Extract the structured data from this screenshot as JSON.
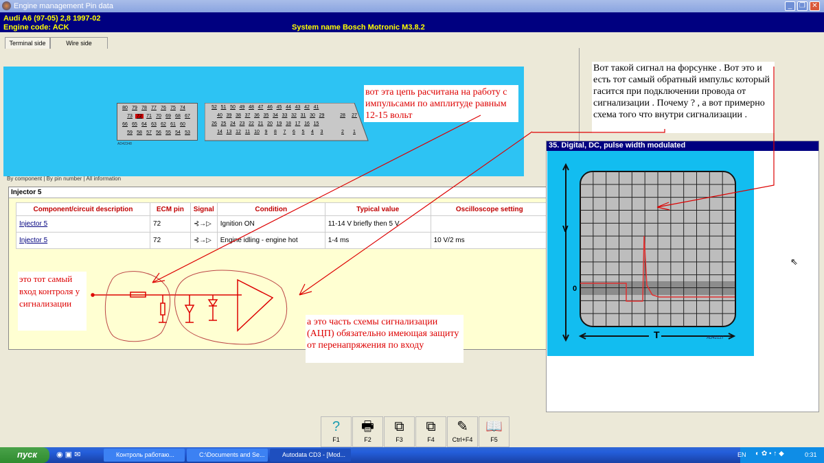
{
  "window": {
    "title": "Engine management Pin data",
    "minimize": "_",
    "maximize": "❐",
    "close": "✕"
  },
  "header": {
    "vehicle": "Audi   A6 (97-05) 2,8  1997-02",
    "engine_code": "Engine code: ACK",
    "system_name": "System name Bosch Motronic M3.8.2"
  },
  "tabs": [
    "Terminal side",
    "Wire side"
  ],
  "connector": {
    "left_rows": [
      [
        "80",
        "79",
        "78",
        "77",
        "76",
        "75",
        "74"
      ],
      [
        "73",
        "72",
        "71",
        "70",
        "69",
        "68",
        "67"
      ],
      [
        "66",
        "65",
        "64",
        "63",
        "62",
        "61",
        "60"
      ],
      [
        "59",
        "58",
        "57",
        "56",
        "55",
        "54",
        "53"
      ]
    ],
    "right_rows": [
      [
        "52",
        "51",
        "50",
        "49",
        "48",
        "47",
        "46",
        "45",
        "44",
        "43",
        "42",
        "41"
      ],
      [
        "40",
        "39",
        "38",
        "37",
        "36",
        "35",
        "34",
        "33",
        "32",
        "31",
        "30",
        "29",
        "28",
        "27"
      ],
      [
        "26",
        "25",
        "24",
        "23",
        "22",
        "21",
        "20",
        "19",
        "18",
        "17",
        "16",
        "15"
      ],
      [
        "14",
        "13",
        "12",
        "11",
        "10",
        "9",
        "8",
        "7",
        "6",
        "5",
        "4",
        "3",
        "2",
        "1"
      ]
    ],
    "highlighted_pin": "72",
    "highlight_color": "#cc0000",
    "ref": "AD42348"
  },
  "subtabs": "By component | By pin number | All information",
  "component": {
    "title": "Injector 5",
    "columns": [
      "Component/circuit description",
      "ECM pin",
      "Signal",
      "Condition",
      "Typical value",
      "Oscilloscope setting"
    ],
    "rows": [
      {
        "desc": "Injector 5",
        "pin": "72",
        "signal": "⊰→▷",
        "condition": "Ignition ON",
        "typical": "11-14 V briefly then 5 V",
        "scope": ""
      },
      {
        "desc": "Injector 5",
        "pin": "72",
        "signal": "⊰→▷",
        "condition": "Engine idling - engine hot",
        "typical": "1-4 ms",
        "scope": "10 V/2 ms"
      }
    ]
  },
  "notes": {
    "circuit": "вот эта цепь расчитана на работу с импульсами по амплитуде равным 12-15 вольт",
    "signal": "Вот такой сигнал на форсунке . Вот это и есть тот самый обратный импульс который гасится при подключении провода от сигнализации . Почему ? , а вот примерно схема того что внутри сигнализации .",
    "input": "это тот  самый вход контроля у сигнализации",
    "adc": "а это часть схемы сигнализации (АЦП) обязательно имеющая защиту от перенапряжения по входу",
    "color": "#dd0000"
  },
  "scope": {
    "title": "35. Digital, DC, pulse width modulated",
    "y_label": "V",
    "zero_label": "0",
    "x_label": "T",
    "ref": "AD42127"
  },
  "toolbar": [
    {
      "icon": "help-icon",
      "glyph": "?",
      "label": "F1"
    },
    {
      "icon": "print-icon",
      "glyph": "🖶",
      "label": "F2"
    },
    {
      "icon": "copy-icon",
      "glyph": "⧉",
      "label": "F3"
    },
    {
      "icon": "paste-icon",
      "glyph": "⧉",
      "label": "F4"
    },
    {
      "icon": "notes-icon",
      "glyph": "✎",
      "label": "Ctrl+F4"
    },
    {
      "icon": "book-icon",
      "glyph": "📖",
      "label": "F5"
    }
  ],
  "taskbar": {
    "start": "пуск",
    "tasks": [
      "Контроль работаю...",
      "C:\\Documents and Se...",
      "Autodata CD3 - [Mod..."
    ],
    "lang": "EN",
    "clock": "0:31"
  }
}
